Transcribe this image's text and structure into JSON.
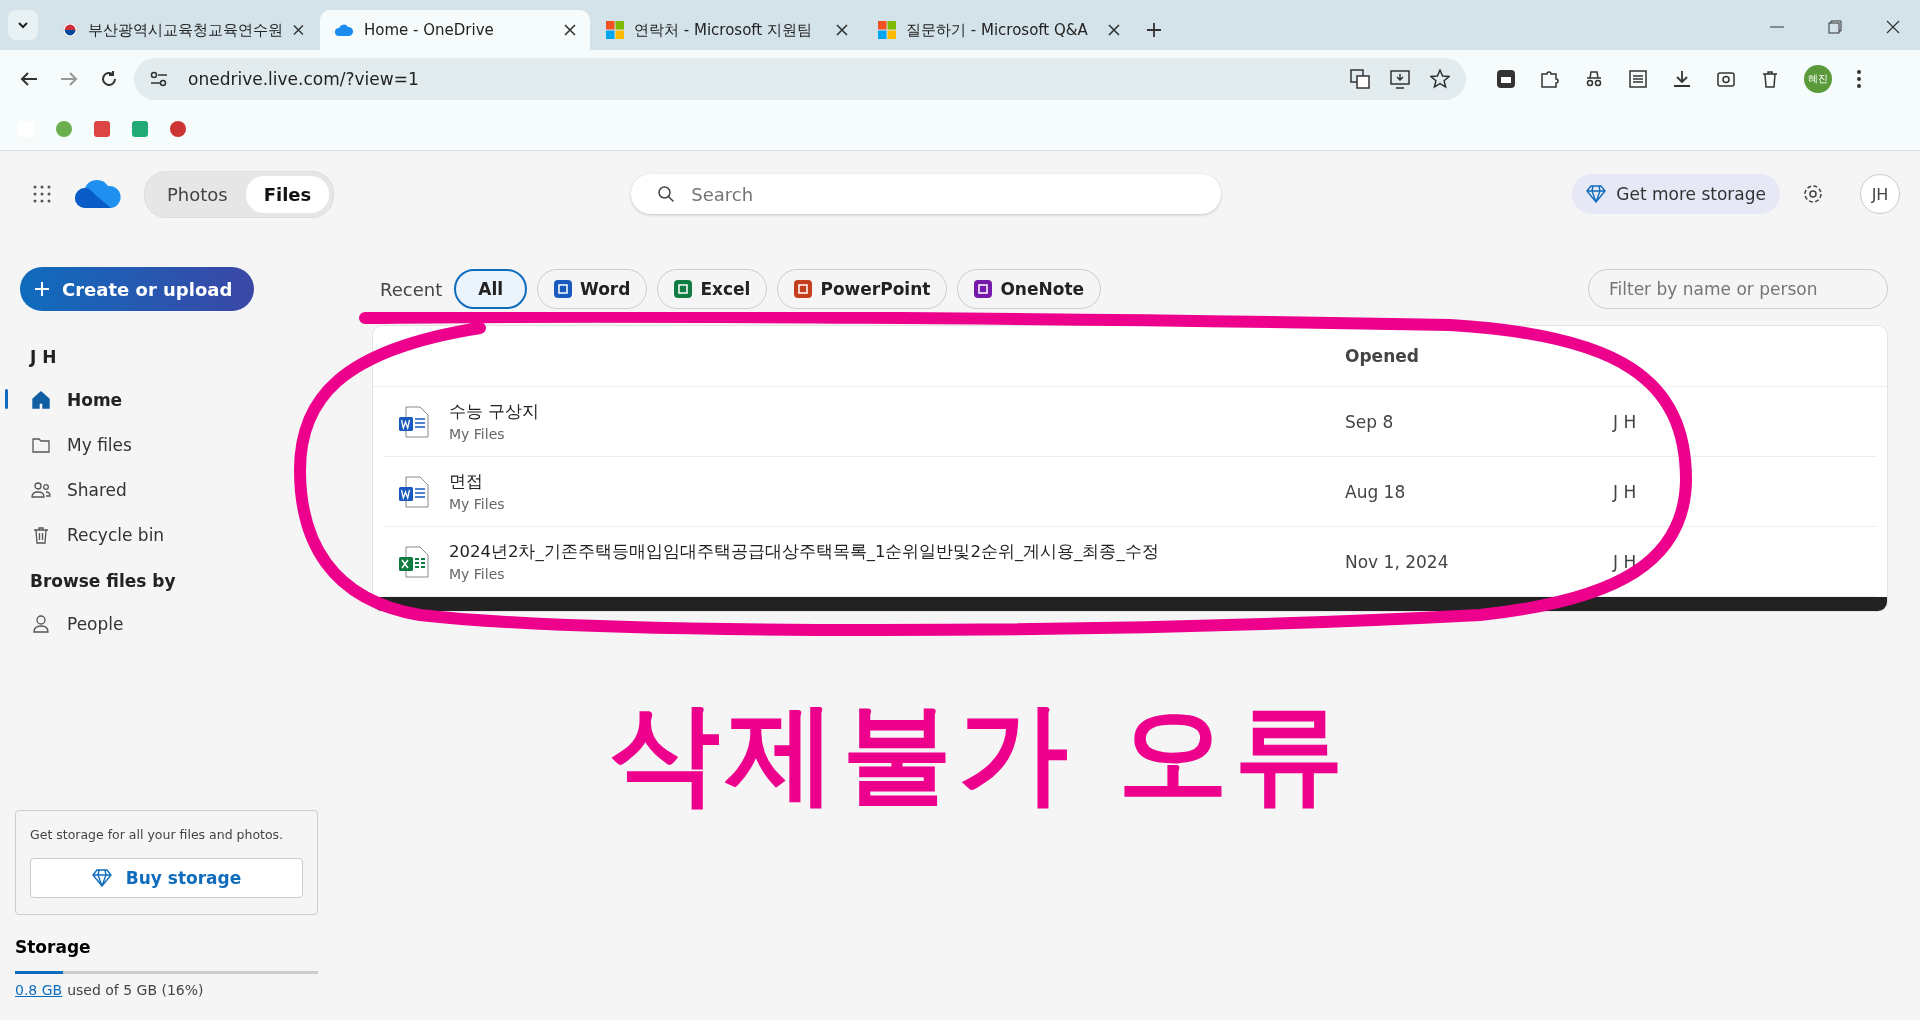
{
  "browser": {
    "tabs": [
      {
        "title": "부산광역시교육청교육연수원",
        "selected": false
      },
      {
        "title": "Home - OneDrive",
        "selected": true
      },
      {
        "title": "연락처 - Microsoft 지원팀",
        "selected": false
      },
      {
        "title": "질문하기 - Microsoft Q&A",
        "selected": false
      }
    ],
    "url": "onedrive.live.com/?view=1",
    "profile": "혜진"
  },
  "header": {
    "switch": [
      {
        "label": "Photos",
        "selected": false
      },
      {
        "label": "Files",
        "selected": true
      }
    ],
    "search_placeholder": "Search",
    "storage_button": "Get more storage",
    "avatar": "JH"
  },
  "sidebar": {
    "create_button": "Create or upload",
    "user": "J H",
    "items": [
      {
        "label": "Home",
        "selected": true
      },
      {
        "label": "My files",
        "selected": false
      },
      {
        "label": "Shared",
        "selected": false
      },
      {
        "label": "Recycle bin",
        "selected": false
      }
    ],
    "browse_heading": "Browse files by",
    "browse_items": [
      {
        "label": "People",
        "selected": false
      }
    ],
    "promo": {
      "text": "Get storage for all your files and photos.",
      "button": "Buy storage"
    },
    "storage": {
      "heading": "Storage",
      "used": "0.8 GB",
      "rest": "used of 5 GB (16%)",
      "level": 0.16
    }
  },
  "filters": {
    "label": "Recent",
    "chips": [
      {
        "label": "All",
        "kind": "all",
        "selected": true
      },
      {
        "label": "Word",
        "kind": "word",
        "selected": false
      },
      {
        "label": "Excel",
        "kind": "excel",
        "selected": false
      },
      {
        "label": "PowerPoint",
        "kind": "powerpoint",
        "selected": false
      },
      {
        "label": "OneNote",
        "kind": "onenote",
        "selected": false
      }
    ],
    "filter_placeholder": "Filter by name or person"
  },
  "table": {
    "columns": [
      "Opened"
    ],
    "rows": [
      {
        "kind": "word",
        "name": "수능 구상지",
        "location": "My Files",
        "opened": "Sep 8",
        "owner": "J H"
      },
      {
        "kind": "word",
        "name": "면접",
        "location": "My Files",
        "opened": "Aug 18",
        "owner": "J H"
      },
      {
        "kind": "excel",
        "name": "2024년2차_기존주택등매입임대주택공급대상주택목록_1순위일반및2순위_게시용_최종_수정",
        "location": "My Files",
        "opened": "Nov 1, 2024",
        "owner": "J H"
      }
    ]
  },
  "annotation": {
    "note": "삭제불가 오류"
  }
}
